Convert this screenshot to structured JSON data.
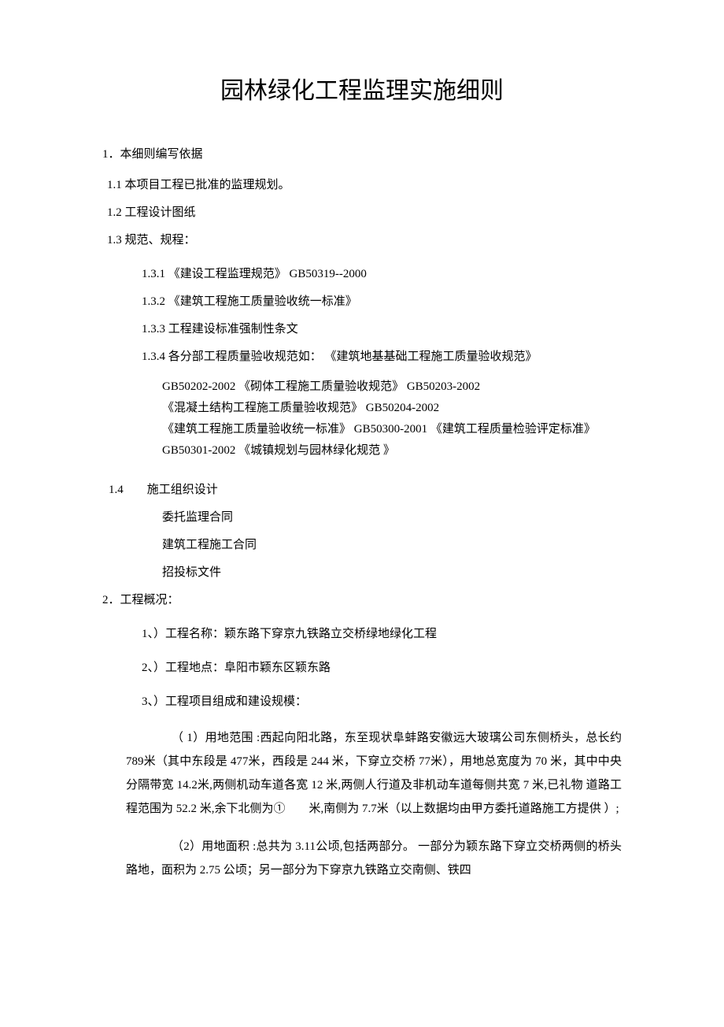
{
  "title": "园林绿化工程监理实施细则",
  "s1": {
    "header": "1．本细则编写依据",
    "i1_1": "1.1 本项目工程已批准的监理规划。",
    "i1_2": "1.2 工程设计图纸",
    "i1_3": "1.3 规范、规程：",
    "i1_3_1": "1.3.1 《建设工程监理规范》 GB50319--2000",
    "i1_3_2": "1.3.2 《建筑工程施工质量验收统一标准》",
    "i1_3_3": "1.3.3 工程建设标准强制性条文",
    "i1_3_4": "1.3.4 各分部工程质量验收规范如： 《建筑地基基础工程施工质量验收规范》",
    "gb_block": "GB50202-2002 《砌体工程施工质量验收规范》 GB50203-2002\n《混凝土结构工程施工质量验收规范》 GB50204-2002\n《建筑工程施工质量验收统一标准》 GB50300-2001 《建筑工程质量检验评定标准》 GB50301-2002 《城镇规划与园林绿化规范 》",
    "i1_4": "1.4　　施工组织设计",
    "i1_4_a": "委托监理合同",
    "i1_4_b": "建筑工程施工合同",
    "i1_4_c": "招投标文件"
  },
  "s2": {
    "header": "2．工程概况：",
    "i1": "1、）工程名称：颖东路下穿京九铁路立交桥绿地绿化工程",
    "i2": "2、）工程地点：阜阳市颖东区颖东路",
    "i3": "3、）工程项目组成和建设规模：",
    "p1": "（ 1）用地范围 :西起向阳北路，东至现状阜蚌路安徽远大玻璃公司东侧桥头，总长约 789米（其中东段是 477米，西段是 244 米，下穿立交桥 77米），用地总宽度为 70 米，其中中央分隔带宽 14.2米,两侧机动车道各宽 12 米,两侧人行道及非机动车道每侧共宽 7 米,已礼物 道路工程范围为 52.2 米,余下北侧为①　　米,南侧为 7.7米（以上数据均由甲方委托道路施工方提供 ）;",
    "p2": "（2）用地面积 :总共为 3.11公顷,包括两部分。 一部分为颖东路下穿立交桥两侧的桥头路地，面积为 2.75 公顷；另一部分为下穿京九铁路立交南侧、铁四"
  }
}
